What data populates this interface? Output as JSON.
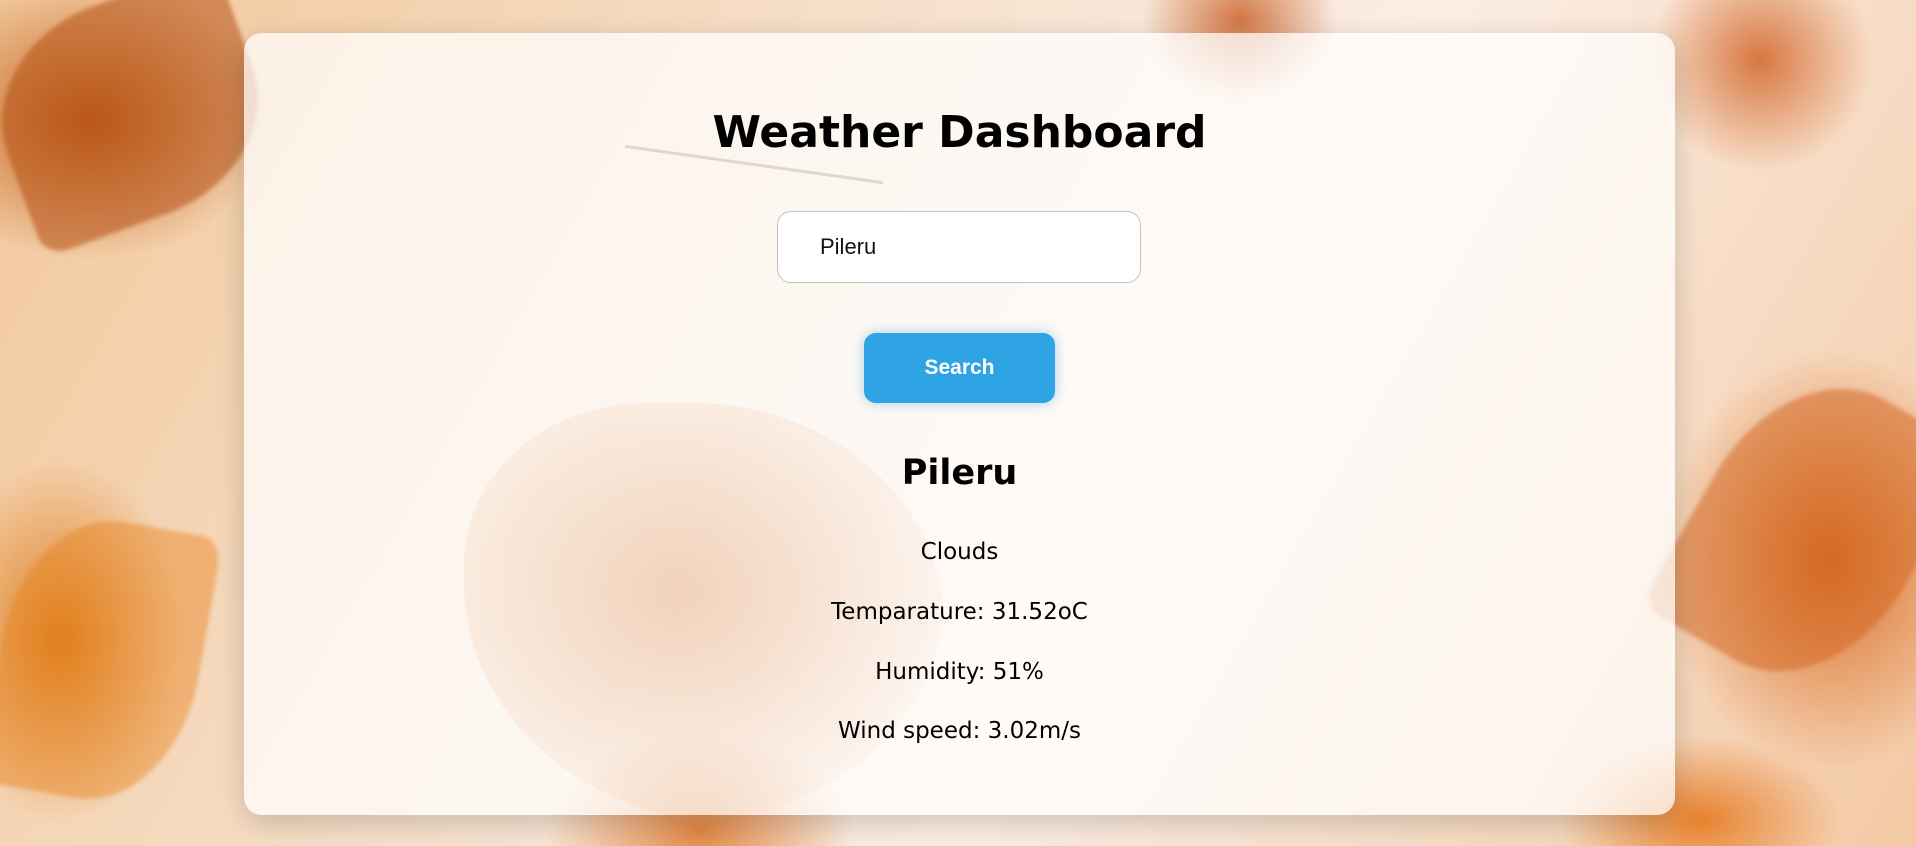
{
  "page": {
    "title": "Weather Dashboard"
  },
  "search": {
    "value": "Pileru",
    "button_label": "Search"
  },
  "weather": {
    "city": "Pileru",
    "condition": "Clouds",
    "temperature_text": "Temparature: 31.52oC",
    "humidity_text": "Humidity: 51%",
    "wind_text": "Wind speed: 3.02m/s"
  },
  "colors": {
    "accent": "#2fa4e4",
    "card_background": "#ffffff",
    "text": "#000000"
  }
}
